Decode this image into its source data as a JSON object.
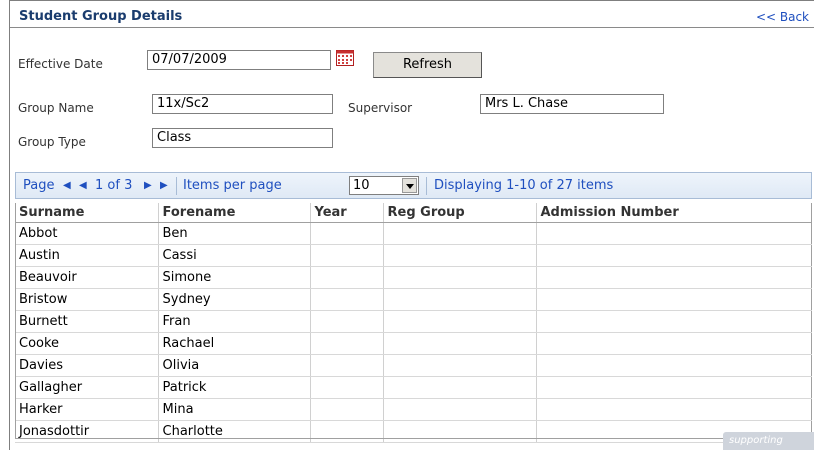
{
  "page": {
    "title": "Student Group Details",
    "back_label": "<< Back"
  },
  "form": {
    "effective_date_label": "Effective Date",
    "effective_date_value": "07/07/2009",
    "refresh_label": "Refresh",
    "group_name_label": "Group Name",
    "group_name_value": "11x/Sc2",
    "supervisor_label": "Supervisor",
    "supervisor_value": "Mrs L. Chase",
    "group_type_label": "Group Type",
    "group_type_value": "Class"
  },
  "pager": {
    "page_label": "Page",
    "position": "1 of 3",
    "items_per_page_label": "Items per page",
    "items_per_page_value": "10",
    "displaying": "Displaying 1-10 of 27 items"
  },
  "table": {
    "columns": [
      "Surname",
      "Forename",
      "Year",
      "Reg Group",
      "Admission Number"
    ],
    "rows": [
      [
        "Abbot",
        "Ben",
        "",
        "",
        ""
      ],
      [
        "Austin",
        "Cassi",
        "",
        "",
        ""
      ],
      [
        "Beauvoir",
        "Simone",
        "",
        "",
        ""
      ],
      [
        "Bristow",
        "Sydney",
        "",
        "",
        ""
      ],
      [
        "Burnett",
        "Fran",
        "",
        "",
        ""
      ],
      [
        "Cooke",
        "Rachael",
        "",
        "",
        ""
      ],
      [
        "Davies",
        "Olivia",
        "",
        "",
        ""
      ],
      [
        "Gallagher",
        "Patrick",
        "",
        "",
        ""
      ],
      [
        "Harker",
        "Mina",
        "",
        "",
        ""
      ],
      [
        "Jonasdottir",
        "Charlotte",
        "",
        "",
        ""
      ]
    ]
  },
  "icons": {
    "calendar": "calendar-icon",
    "first": "first-page-icon",
    "prev": "prev-page-icon",
    "next": "next-page-icon",
    "last": "last-page-icon",
    "dropdown": "chevron-down-icon"
  },
  "watermark": "supporting"
}
